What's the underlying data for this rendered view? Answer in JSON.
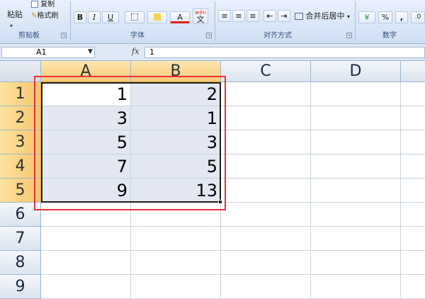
{
  "ribbon": {
    "clipboard": {
      "paste": "粘贴",
      "copy": "复制",
      "format_painter": "格式刷",
      "group": "剪贴板"
    },
    "font": {
      "bold": "B",
      "italic": "I",
      "underline": "U",
      "font_color": "A",
      "wen": "wén",
      "wen_char": "文",
      "group": "字体"
    },
    "alignment": {
      "merge_center": "合并后居中",
      "group": "对齐方式"
    },
    "number": {
      "percent": "%",
      "comma": ",",
      "decimals": ".0",
      "group": "数字"
    }
  },
  "formula_bar": {
    "name_box": "A1",
    "fx_label": "fx",
    "formula_value": "1"
  },
  "grid": {
    "columns": [
      "A",
      "B",
      "C",
      "D"
    ],
    "rows": [
      "1",
      "2",
      "3",
      "4",
      "5",
      "6",
      "7",
      "8",
      "9"
    ],
    "cells": {
      "A1": "1",
      "B1": "2",
      "A2": "3",
      "B2": "1",
      "A3": "5",
      "B3": "3",
      "A4": "7",
      "B4": "5",
      "A5": "9",
      "B5": "13"
    }
  },
  "colors": {
    "highlight_box": "#e8333a",
    "header_selected": "#f7c877",
    "range_fill": "#e4e8f2"
  }
}
